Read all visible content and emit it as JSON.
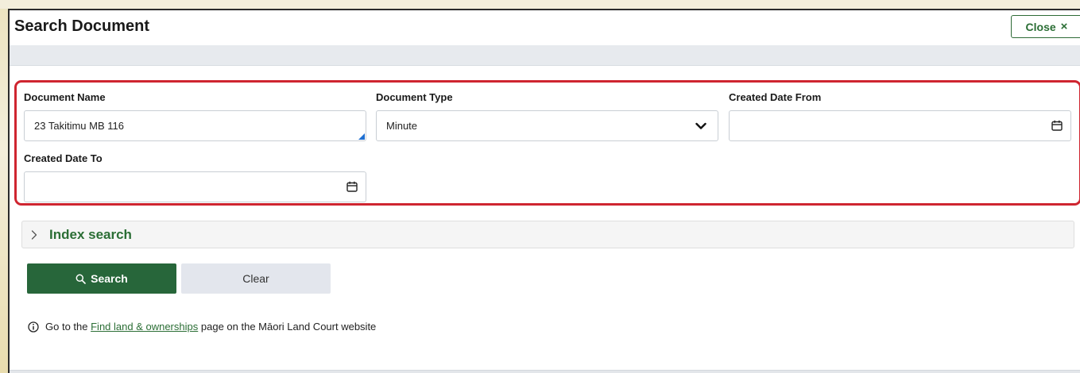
{
  "dialog": {
    "title": "Search Document",
    "close_label": "Close"
  },
  "filters": {
    "document_name": {
      "label": "Document Name",
      "value": "23 Takitimu MB 116"
    },
    "document_type": {
      "label": "Document Type",
      "selected": "Minute"
    },
    "created_from": {
      "label": "Created Date From",
      "value": ""
    },
    "created_to": {
      "label": "Created Date To",
      "value": ""
    }
  },
  "index_search": {
    "label": "Index search",
    "expanded": false
  },
  "actions": {
    "search_label": "Search",
    "clear_label": "Clear"
  },
  "info": {
    "prefix": "Go to the",
    "link_text": "Find land & ownerships",
    "suffix": "page on the Māori Land Court website"
  },
  "colors": {
    "accent_green": "#27663a",
    "highlight_red": "#cf2530",
    "resize_blue": "#1f6fd1"
  },
  "icons": [
    "close-icon",
    "chevron-down-icon",
    "calendar-icon",
    "chevron-right-icon",
    "search-icon",
    "info-icon"
  ]
}
